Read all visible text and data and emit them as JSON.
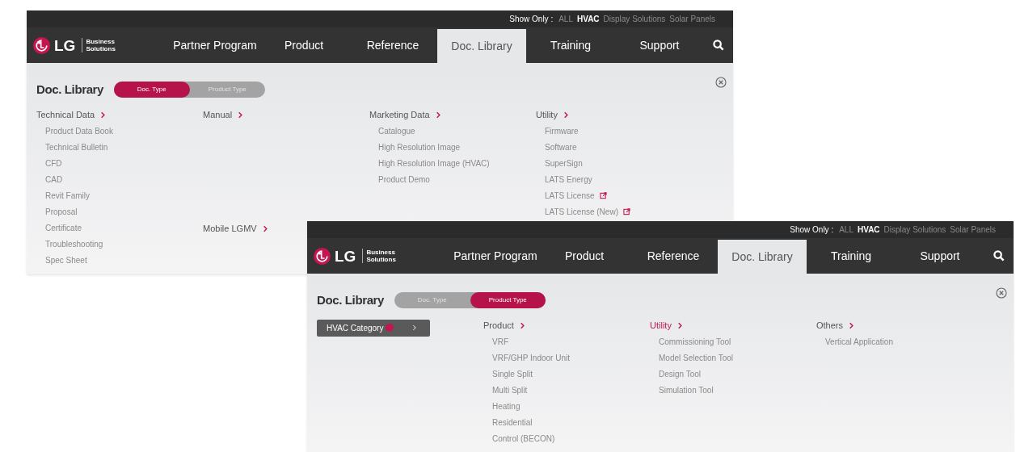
{
  "screens": [
    {
      "show_only": {
        "label": "Show Only :",
        "options": [
          {
            "label": "ALL",
            "selected": false
          },
          {
            "label": "HVAC",
            "selected": true
          },
          {
            "label": "Display Solutions",
            "selected": false
          },
          {
            "label": "Solar Panels",
            "selected": false
          }
        ]
      },
      "logo": {
        "mark": "LG",
        "tagline_1": "Business",
        "tagline_2": "Solutions"
      },
      "nav": [
        {
          "label": "Partner Program",
          "selected": false
        },
        {
          "label": "Product",
          "selected": false
        },
        {
          "label": "Reference",
          "selected": false
        },
        {
          "label": "Doc. Library",
          "selected": true
        },
        {
          "label": "Training",
          "selected": false
        },
        {
          "label": "Support",
          "selected": false
        }
      ],
      "panel": {
        "title": "Doc. Library",
        "toggle": [
          {
            "label": "Doc. Type",
            "selected": true
          },
          {
            "label": "Product Type",
            "selected": false
          }
        ],
        "columns": [
          {
            "groups": [
              {
                "heading": "Technical Data",
                "highlighted": false,
                "items": [
                  {
                    "label": "Product Data Book"
                  },
                  {
                    "label": "Technical Bulletin"
                  },
                  {
                    "label": "CFD"
                  },
                  {
                    "label": "CAD"
                  },
                  {
                    "label": "Revit Family"
                  },
                  {
                    "label": "Proposal"
                  },
                  {
                    "label": "Certificate"
                  },
                  {
                    "label": "Troubleshooting"
                  },
                  {
                    "label": "Spec Sheet"
                  }
                ]
              }
            ]
          },
          {
            "groups": [
              {
                "heading": "Manual",
                "highlighted": false
              },
              {
                "heading": "Mobile LGMV",
                "highlighted": false
              }
            ]
          },
          {
            "groups": [
              {
                "heading": "Marketing Data",
                "highlighted": false,
                "items": [
                  {
                    "label": "Catalogue"
                  },
                  {
                    "label": "High Resolution Image"
                  },
                  {
                    "label": "High Resolution Image (HVAC)"
                  },
                  {
                    "label": "Product Demo"
                  }
                ]
              }
            ]
          },
          {
            "groups": [
              {
                "heading": "Utility",
                "highlighted": false,
                "items": [
                  {
                    "label": "Firmware"
                  },
                  {
                    "label": "Software"
                  },
                  {
                    "label": "SuperSign"
                  },
                  {
                    "label": "LATS Energy"
                  },
                  {
                    "label": "LATS License",
                    "external": true
                  },
                  {
                    "label": "LATS License (New)",
                    "external": true
                  }
                ]
              }
            ]
          }
        ]
      }
    },
    {
      "show_only": {
        "label": "Show Only :",
        "options": [
          {
            "label": "ALL",
            "selected": false
          },
          {
            "label": "HVAC",
            "selected": true
          },
          {
            "label": "Display Solutions",
            "selected": false
          },
          {
            "label": "Solar Panels",
            "selected": false
          }
        ]
      },
      "logo": {
        "mark": "LG",
        "tagline_1": "Business",
        "tagline_2": "Solutions"
      },
      "nav": [
        {
          "label": "Partner Program",
          "selected": false
        },
        {
          "label": "Product",
          "selected": false
        },
        {
          "label": "Reference",
          "selected": false
        },
        {
          "label": "Doc. Library",
          "selected": true
        },
        {
          "label": "Training",
          "selected": false
        },
        {
          "label": "Support",
          "selected": false
        }
      ],
      "panel": {
        "title": "Doc. Library",
        "toggle": [
          {
            "label": "Doc. Type",
            "selected": false
          },
          {
            "label": "Product Type",
            "selected": true
          }
        ],
        "category_button": {
          "label": "HVAC Category"
        },
        "columns": [
          {
            "groups": [
              {
                "heading": "Product",
                "highlighted": false,
                "items": [
                  {
                    "label": "VRF"
                  },
                  {
                    "label": "VRF/GHP Indoor Unit"
                  },
                  {
                    "label": "Single Split"
                  },
                  {
                    "label": "Multi Split"
                  },
                  {
                    "label": "Heating"
                  },
                  {
                    "label": "Residential"
                  },
                  {
                    "label": "Control (BECON)"
                  }
                ]
              }
            ]
          },
          {
            "groups": [
              {
                "heading": "Utility",
                "highlighted": true,
                "items": [
                  {
                    "label": "Commissioning Tool"
                  },
                  {
                    "label": "Model Selection Tool"
                  },
                  {
                    "label": "Design Tool"
                  },
                  {
                    "label": "Simulation Tool"
                  }
                ]
              }
            ]
          },
          {
            "groups": [
              {
                "heading": "Others",
                "highlighted": false,
                "items": [
                  {
                    "label": "Vertical Application"
                  }
                ]
              }
            ]
          }
        ]
      }
    }
  ]
}
